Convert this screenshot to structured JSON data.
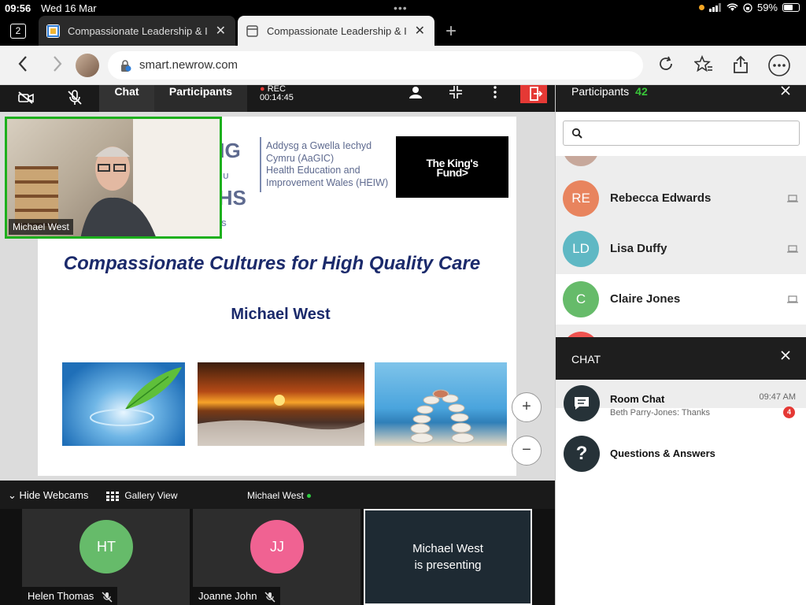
{
  "status_bar": {
    "time": "09:56",
    "date": "Wed 16 Mar",
    "battery": "59%",
    "battery_level": 0.59
  },
  "browser": {
    "tab_count": "2",
    "tabs": [
      {
        "title": "Compassionate Leadership & I",
        "active": false
      },
      {
        "title": "Compassionate Leadership & I",
        "active": true
      }
    ],
    "url": "smart.newrow.com"
  },
  "meeting": {
    "tabs": {
      "chat": "Chat",
      "participants": "Participants"
    },
    "rec_label": "REC",
    "rec_time": "00:14:45",
    "slide": {
      "logo_nhs_lines": [
        "GIG",
        "NHS"
      ],
      "logo_nhs_small": [
        "YMRU",
        "ALES"
      ],
      "logo_lines": [
        "Addysg a Gwella Iechyd",
        "Cymru (AaGIC)",
        "Health Education and",
        "Improvement Wales (HEIW)"
      ],
      "kings_fund_logo": [
        "The King's",
        "Fund>"
      ],
      "title": "Compassionate Cultures for High Quality Care",
      "author": "Michael West"
    },
    "zoom_in": "+",
    "zoom_out": "−",
    "speaker_name": "Michael West",
    "webcam_bar": {
      "hide": "Hide Webcams",
      "gallery": "Gallery View",
      "presenter": "Michael West"
    },
    "cams": [
      {
        "initials": "HT",
        "name": "Helen Thomas",
        "color": "#66bb6a"
      },
      {
        "initials": "JJ",
        "name": "Joanne John",
        "color": "#f06292"
      }
    ],
    "presenting_lines": [
      "Michael West",
      "is presenting"
    ]
  },
  "participants": {
    "title": "Participants",
    "count": "42",
    "list": [
      {
        "initials": "RE",
        "name": "Rebecca Edwards",
        "color": "#e8845e"
      },
      {
        "initials": "LD",
        "name": "Lisa Duffy",
        "color": "#5fb8c4"
      },
      {
        "initials": "C",
        "name": "Claire Jones",
        "color": "#66bb6a"
      }
    ],
    "partial_top_color": "#c7a89b",
    "partial_bottom_color": "#ef5350"
  },
  "chat": {
    "title": "CHAT",
    "items": [
      {
        "title": "Room Chat",
        "subtitle": "Beth Parry-Jones: Thanks",
        "time": "09:47 AM",
        "badge": "4"
      },
      {
        "title": "Questions & Answers"
      }
    ]
  },
  "colors": {
    "accent_green": "#1db01d",
    "leave_red": "#e53935",
    "slide_navy": "#1b2a6b"
  }
}
